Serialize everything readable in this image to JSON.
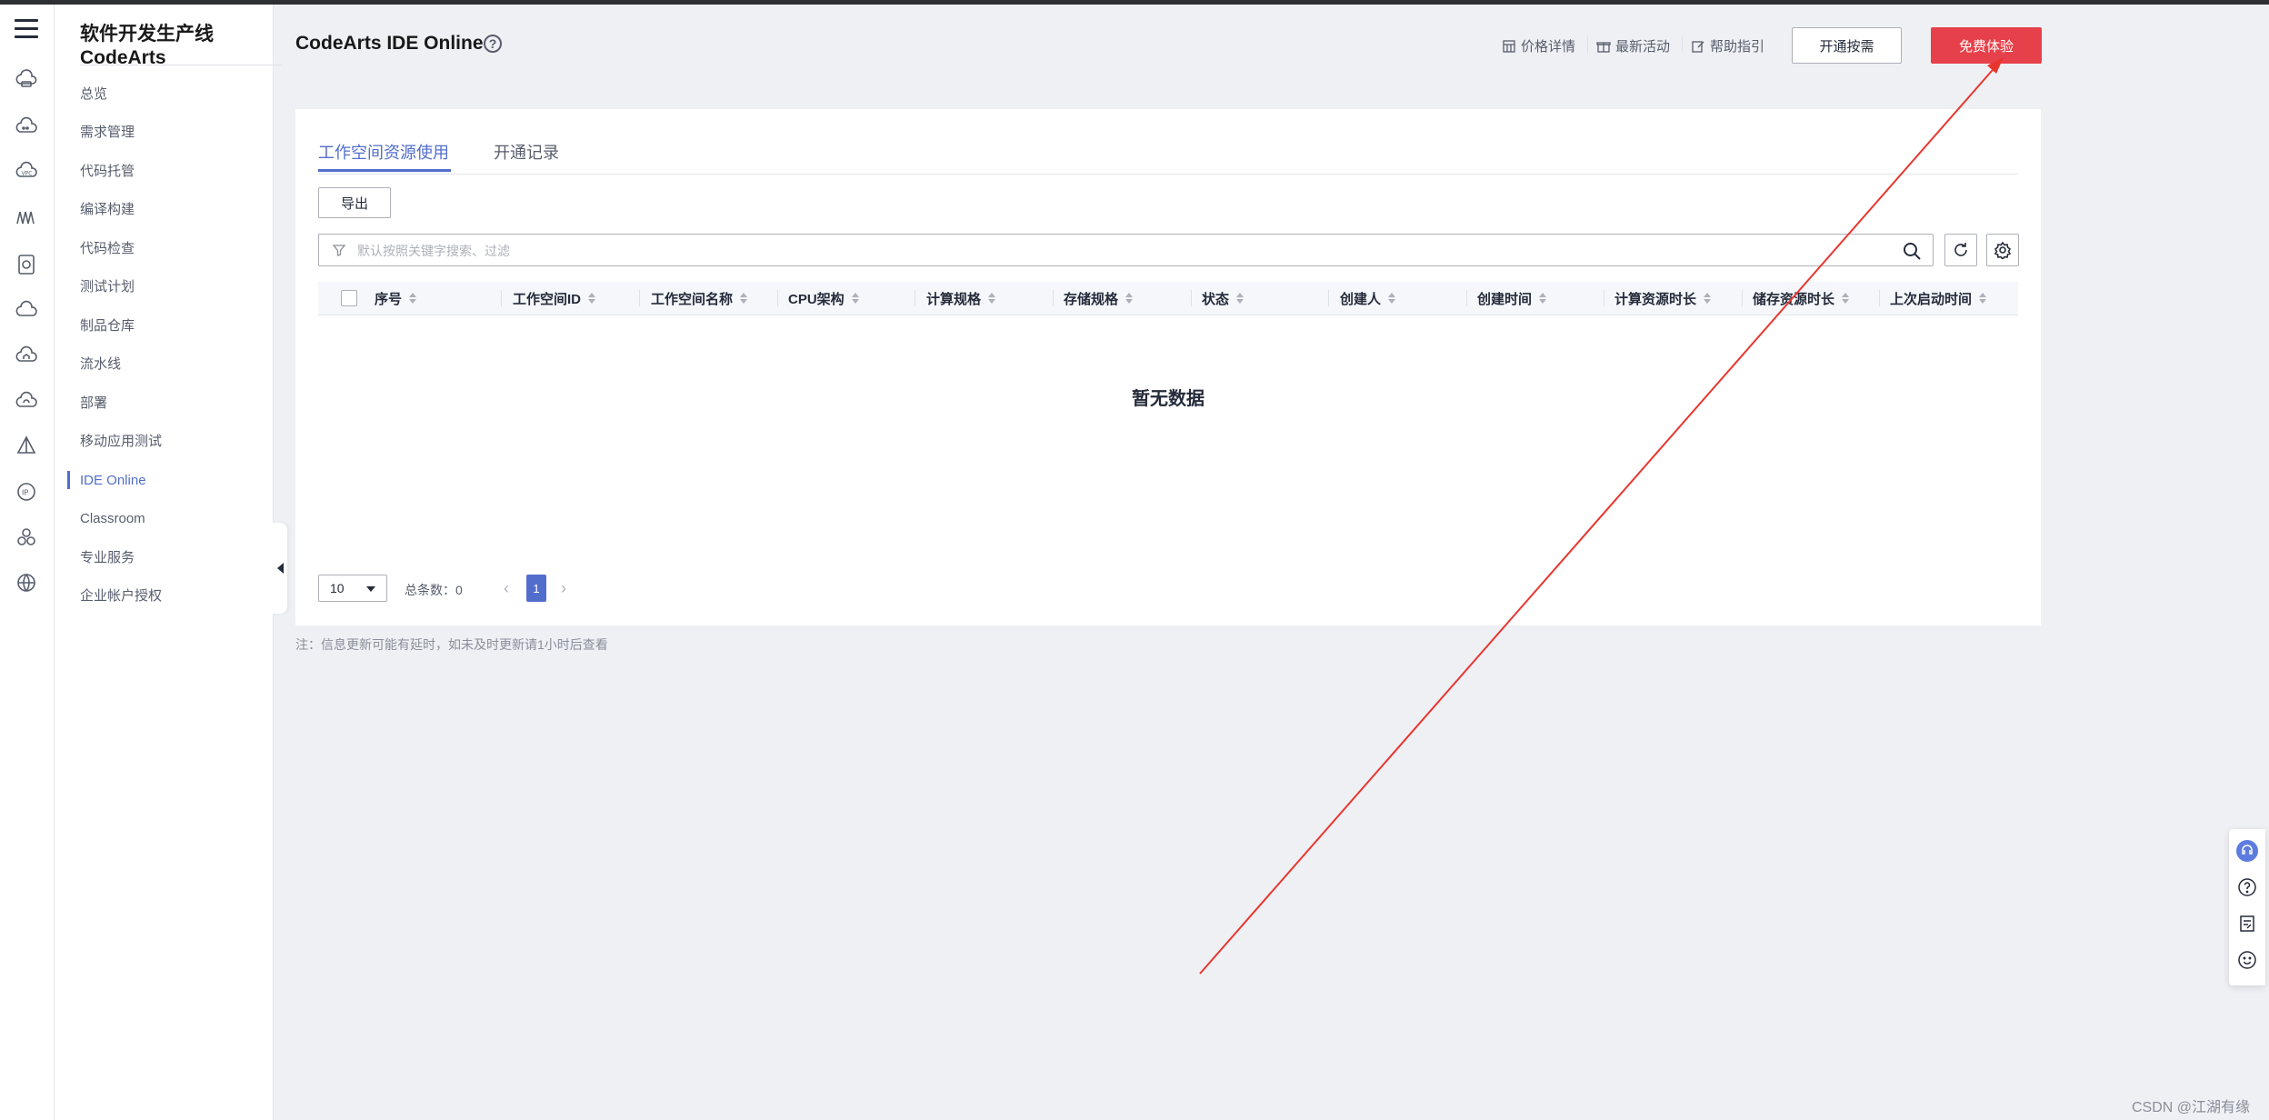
{
  "sidebar": {
    "title_line1": "软件开发生产线",
    "title_line2": "CodeArts",
    "items": [
      {
        "label": "总览"
      },
      {
        "label": "需求管理"
      },
      {
        "label": "代码托管"
      },
      {
        "label": "编译构建"
      },
      {
        "label": "代码检查"
      },
      {
        "label": "测试计划"
      },
      {
        "label": "制品仓库"
      },
      {
        "label": "流水线"
      },
      {
        "label": "部署"
      },
      {
        "label": "移动应用测试"
      },
      {
        "label": "IDE Online",
        "active": true
      },
      {
        "label": "Classroom"
      },
      {
        "label": "专业服务"
      },
      {
        "label": "企业帐户授权"
      }
    ]
  },
  "rail_icons": [
    "menu-icon",
    "cloud-server-icon",
    "cloud-icon",
    "vpc-icon",
    "people-icon",
    "database-icon",
    "cloud-outline-icon",
    "cloud-home-icon",
    "cloud-refresh-icon",
    "pyramid-icon",
    "ip-icon",
    "cluster-icon",
    "globe-icon"
  ],
  "header": {
    "title": "CodeArts IDE Online",
    "links": {
      "pricing": "价格详情",
      "activities": "最新活动",
      "help": "帮助指引"
    },
    "open_on_demand": "开通按需",
    "free_trial": "免费体验"
  },
  "tabs": [
    {
      "label": "工作空间资源使用",
      "active": true
    },
    {
      "label": "开通记录",
      "active": false
    }
  ],
  "toolbar": {
    "export_label": "导出",
    "search_placeholder": "默认按照关键字搜索、过滤"
  },
  "table": {
    "columns": [
      "序号",
      "工作空间ID",
      "工作空间名称",
      "CPU架构",
      "计算规格",
      "存储规格",
      "状态",
      "创建人",
      "创建时间",
      "计算资源时长",
      "储存资源时长",
      "上次启动时间"
    ],
    "rows": [],
    "empty_text": "暂无数据"
  },
  "pagination": {
    "page_size": "10",
    "total_label": "总条数：0",
    "current_page": "1"
  },
  "note": "注：信息更新可能有延时，如未及时更新请1小时后查看",
  "watermark": "CSDN @江湖有缘",
  "colors": {
    "accent": "#526ecc",
    "primary_button": "#e6404a",
    "annotation_arrow": "#e8362f"
  }
}
